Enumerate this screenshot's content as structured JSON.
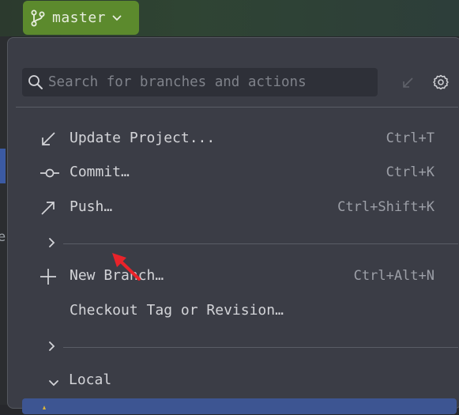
{
  "top_bar": {
    "branch_name": "master"
  },
  "popup": {
    "search": {
      "placeholder": "Search for branches and actions",
      "value": ""
    },
    "actions": [
      {
        "label": "Update Project...",
        "shortcut": "Ctrl+T",
        "icon": "update-arrow-icon"
      },
      {
        "label": "Commit…",
        "shortcut": "Ctrl+K",
        "icon": "commit-icon"
      },
      {
        "label": "Push…",
        "shortcut": "Ctrl+Shift+K",
        "icon": "push-arrow-icon"
      },
      {
        "label": "New Branch…",
        "shortcut": "Ctrl+Alt+N",
        "icon": "plus-icon"
      },
      {
        "label": "Checkout Tag or Revision…",
        "shortcut": "",
        "icon": ""
      }
    ],
    "local_section": {
      "label": "Local"
    }
  },
  "colors": {
    "branch_widget": "#5c8a2d",
    "popup_bg": "#3b3d46",
    "selected_row": "#3d5592",
    "annotation_arrow": "#e8232a"
  }
}
